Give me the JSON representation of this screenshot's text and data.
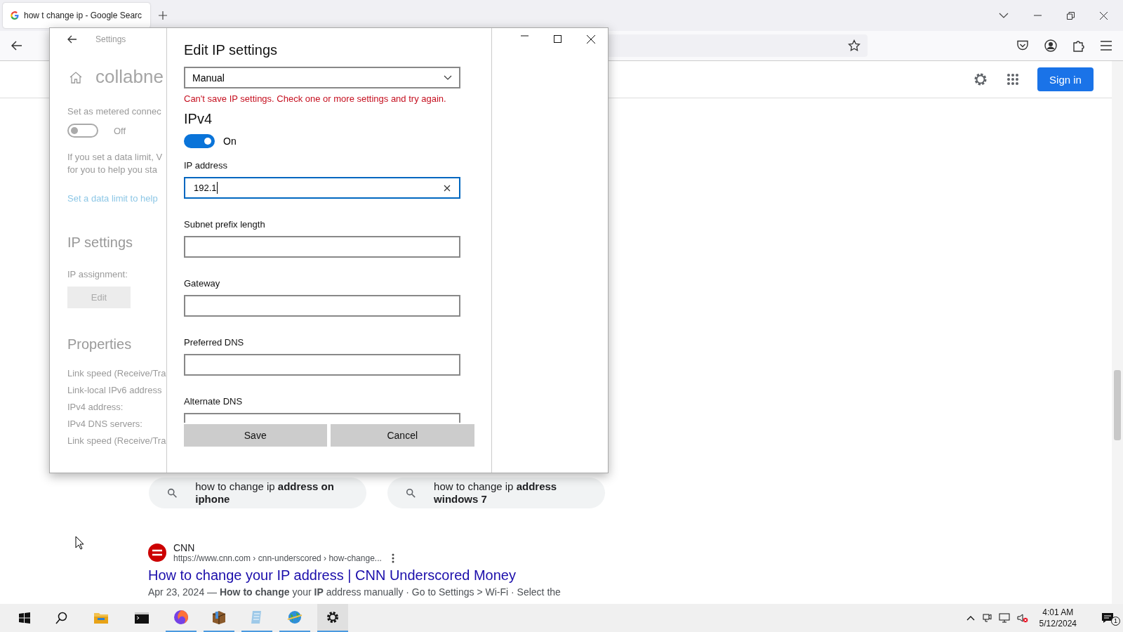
{
  "browser": {
    "tab": {
      "title": "how t change ip - Google Searc",
      "selected": true
    },
    "header": {
      "sign_in": "Sign in"
    },
    "related_searches": [
      {
        "text": "how to change ip **address on iphone**"
      },
      {
        "text": "how to change ip **address windows 7**"
      }
    ],
    "result": {
      "source": "CNN",
      "url": "https://www.cnn.com › cnn-underscored › how-change...",
      "title": "How to change your IP address | CNN Underscored Money",
      "snippet": "Apr 23, 2024 — **How to change** your **IP** address manually · Go to Settings > Wi-Fi · Select the"
    }
  },
  "settings_window": {
    "title": "Settings",
    "app_name": "collabne",
    "metered": {
      "label": "Set as metered connec",
      "on": false,
      "state": "Off"
    },
    "description": [
      "If you set a data limit, V",
      "for you to help you sta"
    ],
    "link": "Set a data limit to help",
    "ip_heading": "IP settings",
    "ip_assignment": "IP assignment:",
    "edit_button": "Edit",
    "properties_heading": "Properties",
    "properties": [
      "Link speed (Receive/Tra",
      "Link-local IPv6 address",
      "IPv4 address:",
      "IPv4 DNS servers:",
      "Link speed (Receive/Tra"
    ]
  },
  "dialog": {
    "title": "Edit IP settings",
    "assignment": "Manual",
    "error": "Can't save IP settings. Check one or more settings and try again.",
    "section": "IPv4",
    "ipv4_on": true,
    "state": "On",
    "fields": [
      {
        "label": "IP address",
        "value": "192.1",
        "focused": true
      },
      {
        "label": "Subnet prefix length",
        "focused": false
      },
      {
        "label": "Gateway",
        "focused": false
      },
      {
        "label": "Preferred DNS",
        "focused": false
      },
      {
        "label": "Alternate DNS",
        "focused": false
      }
    ],
    "buttons": [
      "Save",
      "Cancel"
    ]
  },
  "taskbar": {
    "time": "4:01 AM",
    "date": "5/12/2024",
    "notifications": "1"
  }
}
